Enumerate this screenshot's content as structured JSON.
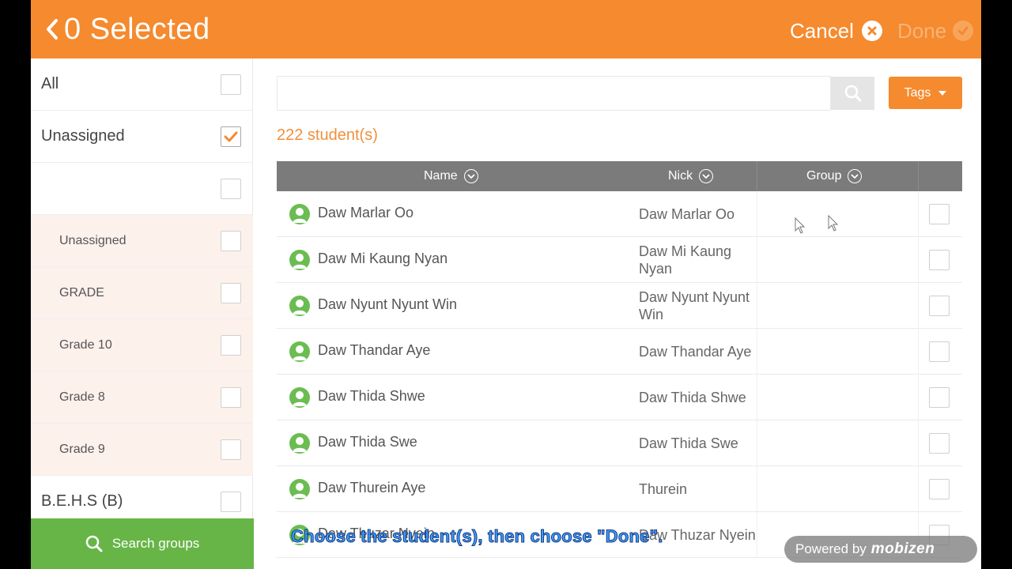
{
  "header": {
    "title": "0 Selected",
    "cancel_label": "Cancel",
    "done_label": "Done"
  },
  "sidebar": {
    "items": [
      {
        "label": "All",
        "checked": false,
        "sub": false
      },
      {
        "label": "Unassigned",
        "checked": true,
        "sub": false
      },
      {
        "label": "",
        "checked": false,
        "sub": false
      },
      {
        "label": "Unassigned",
        "checked": false,
        "sub": true
      },
      {
        "label": "GRADE",
        "checked": false,
        "sub": true
      },
      {
        "label": "Grade 10",
        "checked": false,
        "sub": true
      },
      {
        "label": "Grade 8",
        "checked": false,
        "sub": true
      },
      {
        "label": "Grade 9",
        "checked": false,
        "sub": true
      },
      {
        "label": "B.E.H.S (B)",
        "checked": false,
        "sub": false
      }
    ],
    "search_groups_label": "Search groups"
  },
  "main": {
    "search": {
      "value": "",
      "placeholder": ""
    },
    "tags_label": "Tags",
    "student_count": "222 student(s)",
    "columns": {
      "name": "Name",
      "nick": "Nick",
      "group": "Group"
    },
    "rows": [
      {
        "name": "Daw Marlar Oo",
        "nick": "Daw Marlar Oo",
        "group": "",
        "checked": false
      },
      {
        "name": "Daw Mi Kaung Nyan",
        "nick": "Daw Mi Kaung Nyan",
        "group": "",
        "checked": false
      },
      {
        "name": "Daw Nyunt Nyunt Win",
        "nick": "Daw Nyunt Nyunt Win",
        "group": "",
        "checked": false
      },
      {
        "name": "Daw Thandar Aye",
        "nick": "Daw Thandar Aye",
        "group": "",
        "checked": false
      },
      {
        "name": "Daw Thida Shwe",
        "nick": "Daw Thida Shwe",
        "group": "",
        "checked": false
      },
      {
        "name": "Daw Thida Swe",
        "nick": "Daw Thida Swe",
        "group": "",
        "checked": false
      },
      {
        "name": "Daw Thurein Aye",
        "nick": "Thurein",
        "group": "",
        "checked": false
      },
      {
        "name": "Daw Thuzar Nyein",
        "nick": "Daw Thuzar Nyein",
        "group": "",
        "checked": false
      }
    ]
  },
  "overlay": {
    "caption": "Choose the student(s), then choose \"Done\".",
    "powered_by": "Powered by",
    "powered_brand": "mobizen"
  },
  "colors": {
    "accent": "#f58a2e",
    "green": "#67b547",
    "table_header": "#7b7b7b",
    "sidebar_sub_bg": "#fdf1ec"
  }
}
